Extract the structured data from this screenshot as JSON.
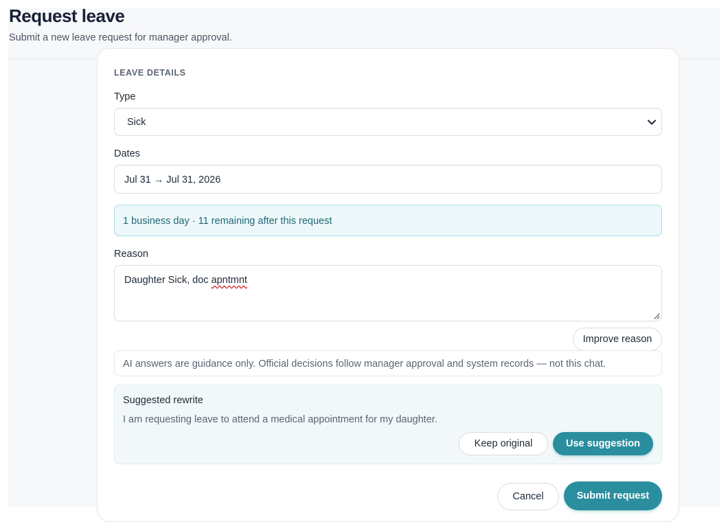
{
  "header": {
    "title": "Request leave",
    "subtitle": "Submit a new leave request for manager approval."
  },
  "form": {
    "section_title": "LEAVE DETAILS",
    "type": {
      "label": "Type",
      "value": "Sick"
    },
    "dates": {
      "label": "Dates",
      "value": "Jul 31 → Jul 31, 2026"
    },
    "summary": "1 business day · 11 remaining after this request",
    "reason": {
      "label": "Reason",
      "value_prefix": "Daughter Sick, doc ",
      "value_misspelled": "apntmnt"
    },
    "improve_button": "Improve reason",
    "disclaimer": "AI answers are guidance only. Official decisions follow manager approval and system records — not this chat.",
    "suggestion": {
      "title": "Suggested rewrite",
      "text": "I am requesting leave to attend a medical appointment for my daughter.",
      "keep_button": "Keep original",
      "use_button": "Use suggestion"
    },
    "cancel_button": "Cancel",
    "submit_button": "Submit request"
  },
  "colors": {
    "accent": "#2a8e9e",
    "info_bg": "#ecf8fa",
    "info_text": "#216878",
    "title": "#172036"
  },
  "icons": {
    "select": "chevron-down-icon",
    "textarea": "resize-handle-icon"
  }
}
